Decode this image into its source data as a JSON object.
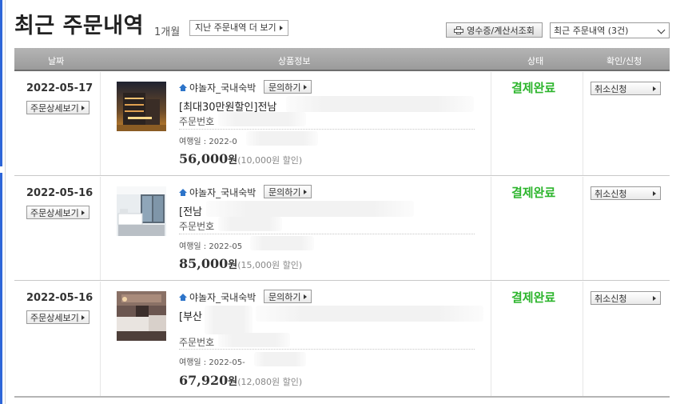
{
  "header": {
    "title": "최근 주문내역",
    "period": "1개월",
    "past_orders_label": "지난 주문내역 더 보기",
    "receipt_label": "영수증/계산서조회",
    "filter_selected": "최근 주문내역 (3건)"
  },
  "table": {
    "columns": [
      "날짜",
      "상품정보",
      "상태",
      "확인/신청"
    ]
  },
  "orders": [
    {
      "date": "2022-05-17",
      "detail_label": "주문상세보기",
      "seller": "야놀자_국내숙박",
      "inquiry_label": "문의하기",
      "product_name": "[최대30만원할인]전남",
      "order_no_label": "주문번호",
      "travel_label": "여행일 : 2022-0",
      "price": "56,000",
      "currency": "원",
      "discount": "(10,000원 할인)",
      "status": "결제완료",
      "action_label": "취소신청"
    },
    {
      "date": "2022-05-16",
      "detail_label": "주문상세보기",
      "seller": "야놀자_국내숙박",
      "inquiry_label": "문의하기",
      "product_name": "[전남",
      "order_no_label": "주문번호",
      "travel_label": "여행일 : 2022-05",
      "price": "85,000",
      "currency": "원",
      "discount": "(15,000원 할인)",
      "status": "결제완료",
      "action_label": "취소신청"
    },
    {
      "date": "2022-05-16",
      "detail_label": "주문상세보기",
      "seller": "야놀자_국내숙박",
      "inquiry_label": "문의하기",
      "product_name": "[부산",
      "order_no_label": "주문번호",
      "travel_label": "여행일 : 2022-05-",
      "price": "67,920",
      "currency": "원",
      "discount": "(12,080원 할인)",
      "status": "결제완료",
      "action_label": "취소신청"
    }
  ],
  "colors": {
    "status_green": "#2db52d",
    "header_gray": "#a8a8a8",
    "icon_blue": "#2d74c9"
  }
}
